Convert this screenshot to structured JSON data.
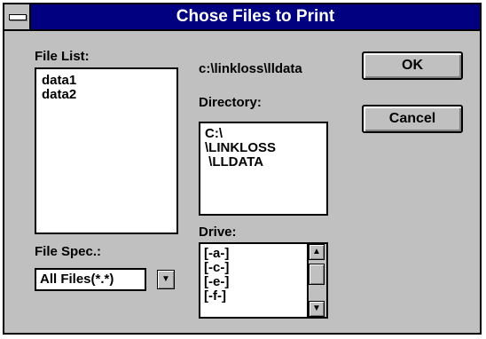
{
  "window": {
    "title": "Chose Files to Print"
  },
  "file_list": {
    "label": "File List:",
    "items": [
      "data1",
      "data2"
    ]
  },
  "current_path": "c:\\linkloss\\lldata",
  "directory": {
    "label": "Directory:",
    "items": [
      "C:\\",
      "\\LINKLOSS",
      " \\LLDATA"
    ]
  },
  "drive": {
    "label": "Drive:",
    "items": [
      "[-a-]",
      "[-c-]",
      "[-e-]",
      "[-f-]"
    ]
  },
  "file_spec": {
    "label": "File Spec.:",
    "value": "All Files(*.*)"
  },
  "buttons": {
    "ok": "OK",
    "cancel": "Cancel"
  },
  "icons": {
    "scroll_up": "▲",
    "scroll_down": "▼",
    "dropdown": "▼"
  }
}
